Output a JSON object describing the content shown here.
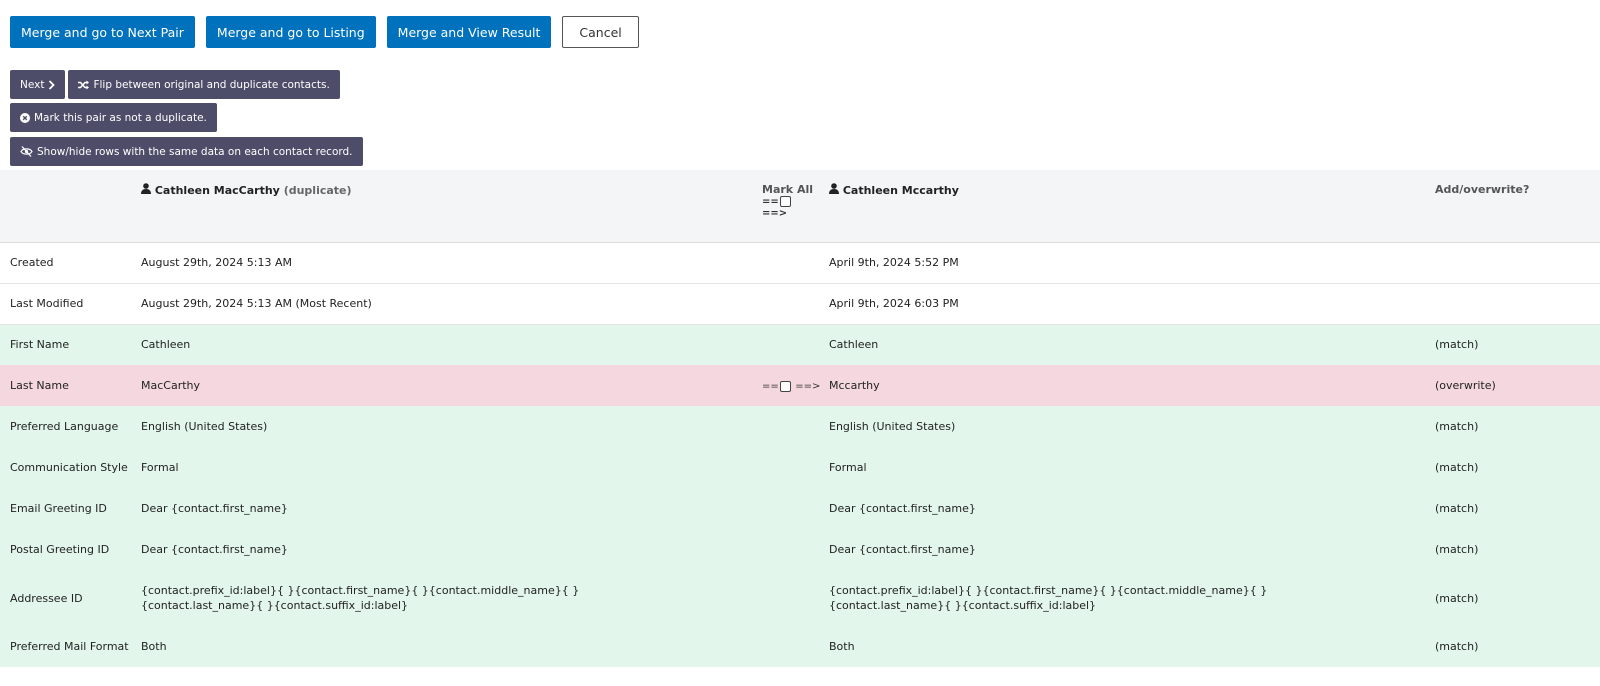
{
  "actions": {
    "merge_next": "Merge and go to Next Pair",
    "merge_listing": "Merge and go to Listing",
    "merge_view": "Merge and View Result",
    "cancel": "Cancel"
  },
  "tools": {
    "next": "Next",
    "flip": "Flip between original and duplicate contacts.",
    "not_duplicate": "Mark this pair as not a duplicate.",
    "show_hide": "Show/hide rows with the same data on each contact record."
  },
  "header": {
    "duplicate_name": "Cathleen MacCarthy",
    "duplicate_tag": "(duplicate)",
    "mark_all": "Mark All",
    "mark_all_prefix": "==",
    "mark_all_arrow": "==>",
    "main_name": "Cathleen Mccarthy",
    "add_overwrite": "Add/overwrite?"
  },
  "rows": [
    {
      "label": "Created",
      "duplicate": "August 29th, 2024 5:13 AM",
      "main": "April 9th, 2024 5:52 PM",
      "status": "",
      "type": "plain"
    },
    {
      "label": "Last Modified",
      "duplicate": "August 29th, 2024 5:13 AM (Most Recent)",
      "main": "April 9th, 2024 6:03 PM",
      "status": "",
      "type": "plain"
    },
    {
      "label": "First Name",
      "duplicate": "Cathleen",
      "main": "Cathleen",
      "status": "(match)",
      "type": "match"
    },
    {
      "label": "Last Name",
      "duplicate": "MacCarthy",
      "main": "Mccarthy",
      "status": "(overwrite)",
      "type": "overwrite",
      "move_prefix": "==",
      "move_arrow": "==>"
    },
    {
      "label": "Preferred Language",
      "duplicate": "English (United States)",
      "main": "English (United States)",
      "status": "(match)",
      "type": "match"
    },
    {
      "label": "Communication Style",
      "duplicate": "Formal",
      "main": "Formal",
      "status": "(match)",
      "type": "match"
    },
    {
      "label": "Email Greeting ID",
      "duplicate": "Dear {contact.first_name}",
      "main": "Dear {contact.first_name}",
      "status": "(match)",
      "type": "match"
    },
    {
      "label": "Postal Greeting ID",
      "duplicate": "Dear {contact.first_name}",
      "main": "Dear {contact.first_name}",
      "status": "(match)",
      "type": "match"
    },
    {
      "label": "Addressee ID",
      "duplicate": "{contact.prefix_id:label}{ }{contact.first_name}{ }{contact.middle_name}{ }{contact.last_name}{ }{contact.suffix_id:label}",
      "main": "{contact.prefix_id:label}{ }{contact.first_name}{ }{contact.middle_name}{ }{contact.last_name}{ }{contact.suffix_id:label}",
      "status": "(match)",
      "type": "match tall"
    },
    {
      "label": "Preferred Mail Format",
      "duplicate": "Both",
      "main": "Both",
      "status": "(match)",
      "type": "match"
    }
  ]
}
